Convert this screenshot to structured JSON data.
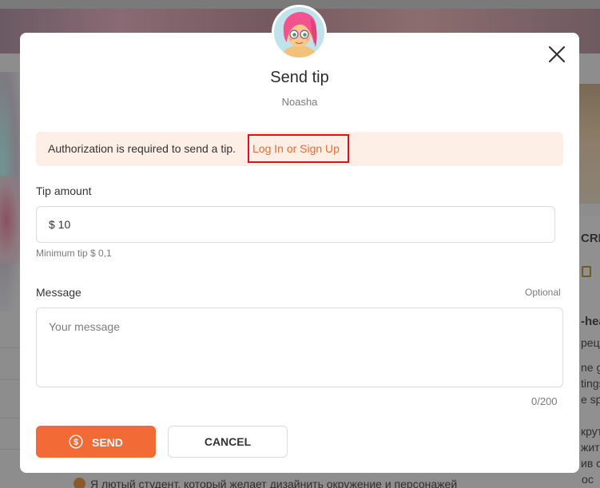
{
  "modal": {
    "title": "Send tip",
    "creator_name": "Noasha",
    "close_icon": "close-icon",
    "avatar": "creator-avatar"
  },
  "alert": {
    "text": "Authorization is required to send a tip.",
    "link_label": "Log In or Sign Up"
  },
  "tip": {
    "label": "Tip amount",
    "value": "$ 10",
    "minimum_hint": "Minimum tip $ 0,1"
  },
  "message": {
    "label": "Message",
    "optional_label": "Optional",
    "placeholder": "Your message",
    "counter": "0/200"
  },
  "buttons": {
    "send_label": "SEND",
    "send_icon": "dollar-coin-icon",
    "cancel_label": "CANCEL"
  },
  "background": {
    "right_snippets": [
      "CRI",
      "-hea",
      "рец",
      "ne go",
      "tings",
      "e sp",
      "крут",
      "жит",
      "ив с",
      "-Микрос"
    ],
    "bottom_text": "Я лютый студент, который желает дизайнить окружение и персонажей"
  },
  "colors": {
    "accent": "#f26a35",
    "alert_bg": "#fdeee6",
    "highlight_border": "#e0101a"
  }
}
